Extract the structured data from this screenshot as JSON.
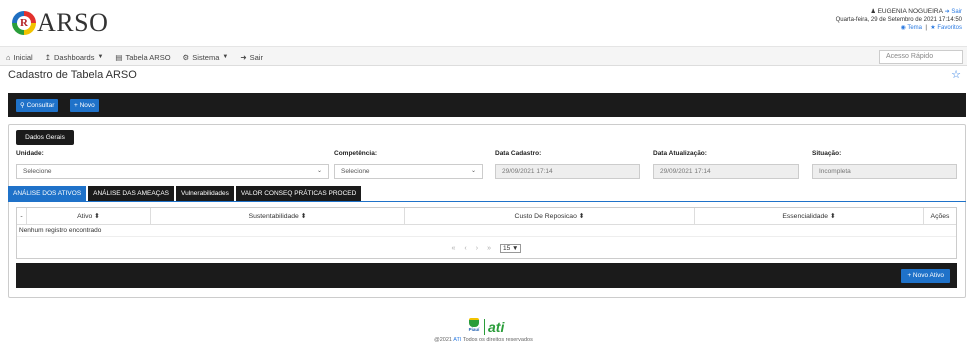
{
  "app": {
    "logo_letter": "R",
    "logo_text": "ARSO"
  },
  "user": {
    "name": "EUGENIA NOGUEIRA",
    "logout": "Sair",
    "datetime": "Quarta-feira, 29 de Setembro de 2021 17:14:50",
    "theme": "Tema",
    "separator": "|",
    "favorites": "Favoritos"
  },
  "nav": {
    "items": [
      {
        "label": "Inicial",
        "icon": "home-icon"
      },
      {
        "label": "Dashboards",
        "icon": "chart-icon",
        "dropdown": true
      },
      {
        "label": "Tabela ARSO",
        "icon": "file-icon"
      },
      {
        "label": "Sistema",
        "icon": "gear-icon",
        "dropdown": true
      },
      {
        "label": "Sair",
        "icon": "logout-icon"
      }
    ],
    "quick_access_placeholder": "Acesso Rápido"
  },
  "page": {
    "title": "Cadastro de Tabela ARSO"
  },
  "actions": {
    "consultar": "Consultar",
    "novo": "Novo"
  },
  "form": {
    "legend": "Dados Gerais",
    "unidade": {
      "label": "Unidade:",
      "value": "Selecione"
    },
    "competencia": {
      "label": "Competência:",
      "value": "Selecione"
    },
    "data_cadastro": {
      "label": "Data Cadastro:",
      "value": "29/09/2021 17:14"
    },
    "data_atualizacao": {
      "label": "Data Atualização:",
      "value": "29/09/2021 17:14"
    },
    "situacao": {
      "label": "Situação:",
      "value": "Incompleta"
    }
  },
  "tabs": [
    {
      "label": "ANÁLISE DOS ATIVOS",
      "active": true
    },
    {
      "label": "ANÁLISE DAS AMEAÇAS",
      "active": false
    },
    {
      "label": "Vulnerabilidades",
      "active": false
    },
    {
      "label": "VALOR CONSEQ PRÁTICAS PROCED",
      "active": false
    }
  ],
  "table": {
    "columns": [
      "-",
      "Ativo ⬍",
      "Sustentabilidade ⬍",
      "Custo De Reposicao ⬍",
      "Essencialidade ⬍",
      "Ações"
    ],
    "empty_message": "Nenhum registro encontrado",
    "pager": {
      "first": "«",
      "prev": "‹",
      "next": "›",
      "last": "»",
      "rows_per_page": "15"
    }
  },
  "bottom": {
    "novo_ativo": "Novo Ativo"
  },
  "footer": {
    "state": "Piauí",
    "brand": "ati",
    "copyright_prefix": "@2021",
    "copyright_link": "ATI",
    "copyright_suffix": "Todos os direitos reservados"
  },
  "colors": {
    "primary": "#1f72c9",
    "dark_bar": "#1b1b1b",
    "link": "#2a7ae2",
    "brand_green": "#2a9d3a"
  }
}
